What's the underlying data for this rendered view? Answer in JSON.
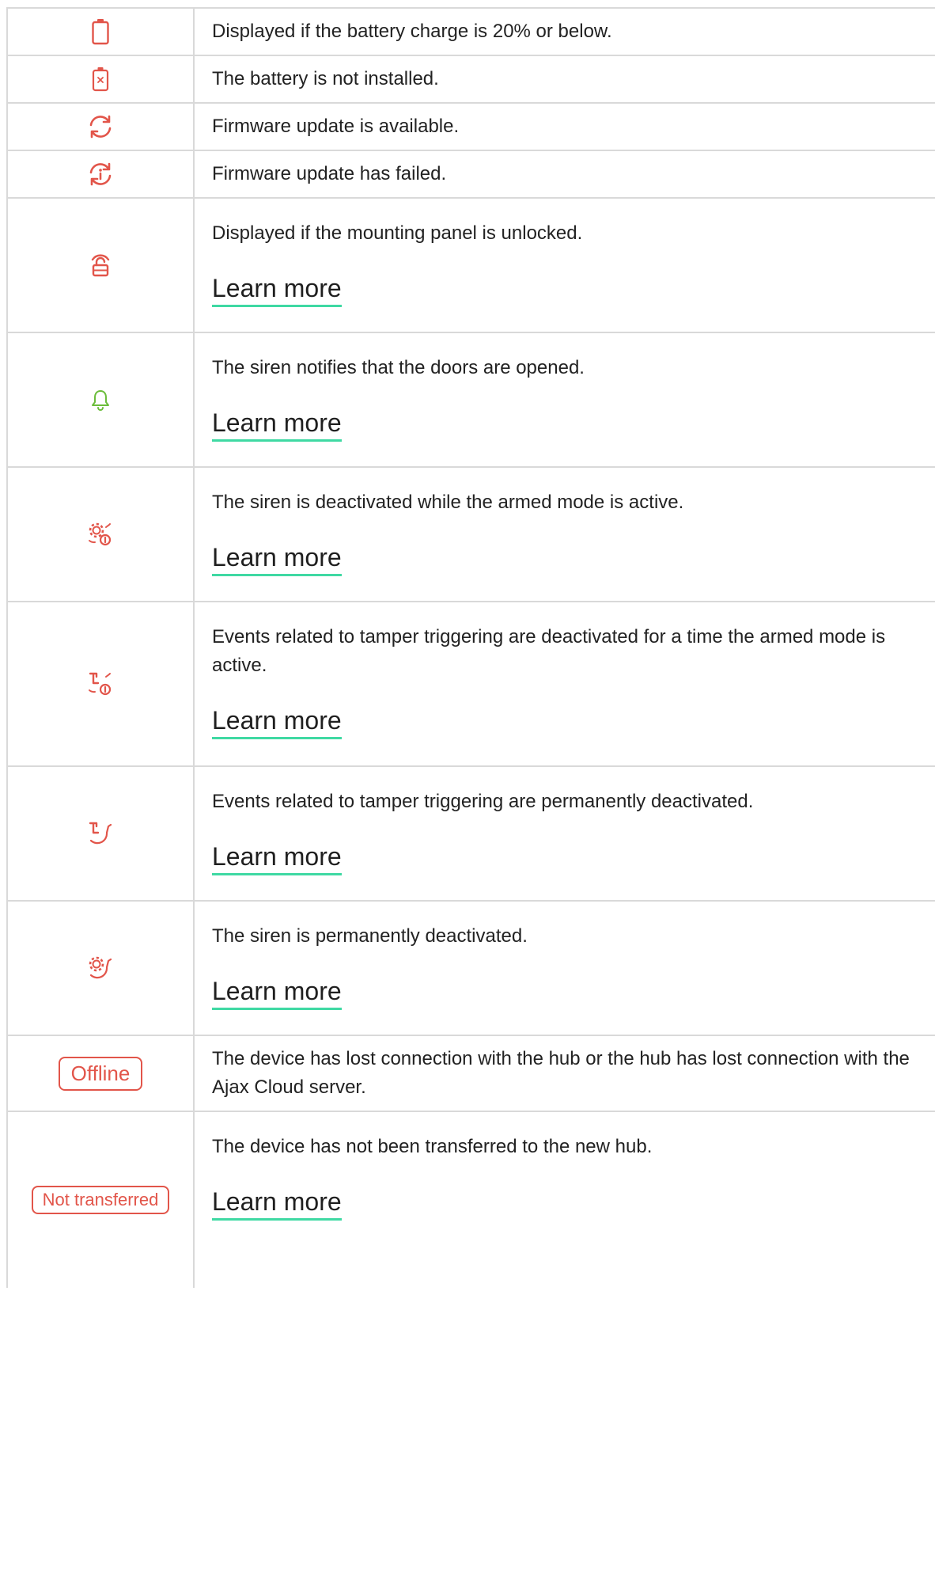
{
  "colors": {
    "icon_red": "#e2554a",
    "icon_green": "#6cbd3b",
    "link_underline": "#3fd9a3",
    "border": "#d9d9d9",
    "text": "#222222"
  },
  "rows": [
    {
      "icon": "battery-low-icon",
      "text": "Displayed if the battery charge is 20% or below."
    },
    {
      "icon": "battery-not-installed-icon",
      "text": "The battery is not installed."
    },
    {
      "icon": "firmware-update-available-icon",
      "text": "Firmware update is available."
    },
    {
      "icon": "firmware-update-failed-icon",
      "text": "Firmware update has failed."
    },
    {
      "icon": "mounting-panel-unlocked-icon",
      "text": "Displayed if the mounting panel is unlocked.",
      "link": "Learn more"
    },
    {
      "icon": "door-chime-bell-icon",
      "text": "The siren notifies that the doors are opened.",
      "link": "Learn more"
    },
    {
      "icon": "siren-deactivated-armed-icon",
      "text": "The siren is deactivated while the armed mode is active.",
      "link": "Learn more"
    },
    {
      "icon": "tamper-deactivated-armed-icon",
      "text": "Events related to tamper triggering are deactivated for a time the armed mode is active.",
      "link": "Learn more"
    },
    {
      "icon": "tamper-permanently-deactivated-icon",
      "text": "Events related to tamper triggering are permanently deactivated.",
      "link": "Learn more"
    },
    {
      "icon": "siren-permanently-deactivated-icon",
      "text": "The siren is permanently deactivated.",
      "link": "Learn more"
    },
    {
      "badge": "Offline",
      "text": "The device has lost connection with the hub or the hub has lost connection with the Ajax Cloud server."
    },
    {
      "badge": "Not transferred",
      "text": "The device has not been transferred to the new hub.",
      "link": "Learn more"
    }
  ]
}
